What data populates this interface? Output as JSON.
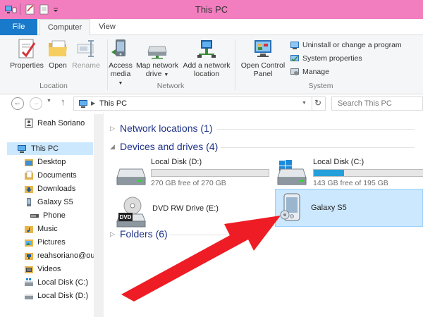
{
  "window": {
    "title": "This PC"
  },
  "tabs": [
    {
      "label": "File"
    },
    {
      "label": "Computer"
    },
    {
      "label": "View"
    }
  ],
  "ribbon": {
    "location_group": {
      "label": "Location",
      "properties": "Properties",
      "open": "Open",
      "rename": "Rename"
    },
    "network_group": {
      "label": "Network",
      "access_media_1": "Access",
      "access_media_2": "media",
      "map_drive_1": "Map network",
      "map_drive_2": "drive",
      "add_location_1": "Add a network",
      "add_location_2": "location"
    },
    "system_group": {
      "label": "System",
      "control_panel_1": "Open Control",
      "control_panel_2": "Panel",
      "uninstall": "Uninstall or change a program",
      "system_properties": "System properties",
      "manage": "Manage"
    }
  },
  "address": {
    "path": "This PC",
    "search_placeholder": "Search This PC"
  },
  "navpane": {
    "user": "Reah Soriano",
    "items": [
      {
        "label": "This PC"
      },
      {
        "label": "Desktop"
      },
      {
        "label": "Documents"
      },
      {
        "label": "Downloads"
      },
      {
        "label": "Galaxy S5"
      },
      {
        "label": "Phone"
      },
      {
        "label": "Music"
      },
      {
        "label": "Pictures"
      },
      {
        "label": "reahsoriano@out"
      },
      {
        "label": "Videos"
      },
      {
        "label": "Local Disk (C:)"
      },
      {
        "label": "Local Disk (D:)"
      }
    ]
  },
  "content": {
    "network_header": "Network locations (1)",
    "devices_header": "Devices and drives (4)",
    "folders_header": "Folders (6)",
    "drives": [
      {
        "name": "Local Disk (D:)",
        "free": "270 GB free of 270 GB",
        "used_fraction": 0.0
      },
      {
        "name": "Local Disk (C:)",
        "free": "143 GB free of 195 GB",
        "used_fraction": 0.27
      },
      {
        "name": "DVD RW Drive (E:)"
      },
      {
        "name": "Galaxy S5"
      }
    ],
    "dvd_badge": "DVD"
  },
  "colors": {
    "titlebar": "#f27ec0",
    "file_tab": "#1979ca",
    "selection": "#cce8ff",
    "drive_bar": "#26a0da",
    "header_text": "#1e3287",
    "arrow": "#ee1c24"
  }
}
